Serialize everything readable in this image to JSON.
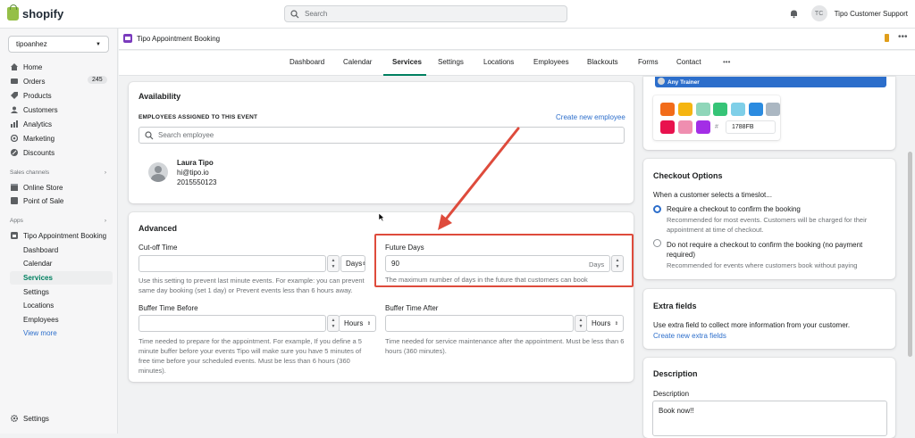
{
  "topbar": {
    "brand": "shopify",
    "search_placeholder": "Search",
    "user_initials": "TC",
    "user_name": "Tipo Customer Support"
  },
  "sidebar": {
    "store": "tipoanhez",
    "items": [
      {
        "label": "Home",
        "icon": "home-icon"
      },
      {
        "label": "Orders",
        "icon": "orders-icon",
        "badge": "245"
      },
      {
        "label": "Products",
        "icon": "products-icon"
      },
      {
        "label": "Customers",
        "icon": "customers-icon"
      },
      {
        "label": "Analytics",
        "icon": "analytics-icon"
      },
      {
        "label": "Marketing",
        "icon": "marketing-icon"
      },
      {
        "label": "Discounts",
        "icon": "discounts-icon"
      }
    ],
    "sales_channels_label": "Sales channels",
    "sales_channels": [
      {
        "label": "Online Store",
        "icon": "online-store-icon"
      },
      {
        "label": "Point of Sale",
        "icon": "pos-icon"
      }
    ],
    "apps_label": "Apps",
    "app_name": "Tipo Appointment Booking",
    "app_subitems": [
      "Dashboard",
      "Calendar",
      "Services",
      "Settings",
      "Locations",
      "Employees"
    ],
    "active_subitem": "Services",
    "view_more": "View more",
    "settings": "Settings"
  },
  "app_header": {
    "title": "Tipo Appointment Booking",
    "more": "•••"
  },
  "tabs": [
    "Dashboard",
    "Calendar",
    "Services",
    "Settings",
    "Locations",
    "Employees",
    "Blackouts",
    "Forms",
    "Contact",
    "•••"
  ],
  "active_tab": "Services",
  "availability": {
    "title": "Availability",
    "employees_label": "EMPLOYEES ASSIGNED TO THIS EVENT",
    "create_employee": "Create new employee",
    "search_placeholder": "Search employee",
    "employee": {
      "name": "Laura Tipo",
      "email": "hi@tipo.io",
      "phone": "2015550123"
    }
  },
  "advanced": {
    "title": "Advanced",
    "cutoff": {
      "label": "Cut-off Time",
      "value": "",
      "unit": "Days",
      "help": "Use this setting to prevent last minute events. For example: you can prevent same day booking (set 1 day) or Prevent events less than 6 hours away."
    },
    "future_days": {
      "label": "Future Days",
      "value": "90",
      "unit": "Days",
      "help": "The maximum number of days in the future that customers can book"
    },
    "buffer_before": {
      "label": "Buffer Time Before",
      "value": "",
      "unit": "Hours",
      "help": "Time needed to prepare for the appointment. For example, If you define a 5 minute buffer before your events Tipo will make sure you have 5 minutes of free time before your scheduled events. Must be less than 6 hours (360 minutes)."
    },
    "buffer_after": {
      "label": "Buffer Time After",
      "value": "",
      "unit": "Hours",
      "help": "Time needed for service maintenance after the appointment. Must be less than 6 hours (360 minutes)."
    }
  },
  "color_picker": {
    "trainer_label": "Any Trainer",
    "colors": [
      "#f26c1a",
      "#f5b511",
      "#8fd6b9",
      "#36c477",
      "#7fcfe8",
      "#2b8be0",
      "#abb7c2",
      "#e8124e",
      "#ef8eb0",
      "#a32ee6"
    ],
    "hash": "#",
    "hex_value": "1788FB"
  },
  "checkout": {
    "title": "Checkout Options",
    "subtitle": "When a customer selects a timeslot...",
    "options": [
      {
        "label": "Require a checkout to confirm the booking",
        "help": "Recommended for most events. Customers will be charged for their appointment at time of checkout.",
        "selected": true
      },
      {
        "label": "Do not require a checkout to confirm the booking (no payment required)",
        "help": "Recommended for events where customers book without paying",
        "selected": false
      }
    ]
  },
  "extra_fields": {
    "title": "Extra fields",
    "text": "Use extra field to collect more information from your customer.",
    "link": "Create new extra fields"
  },
  "description": {
    "title": "Description",
    "label": "Description",
    "value": "Book now!!"
  }
}
